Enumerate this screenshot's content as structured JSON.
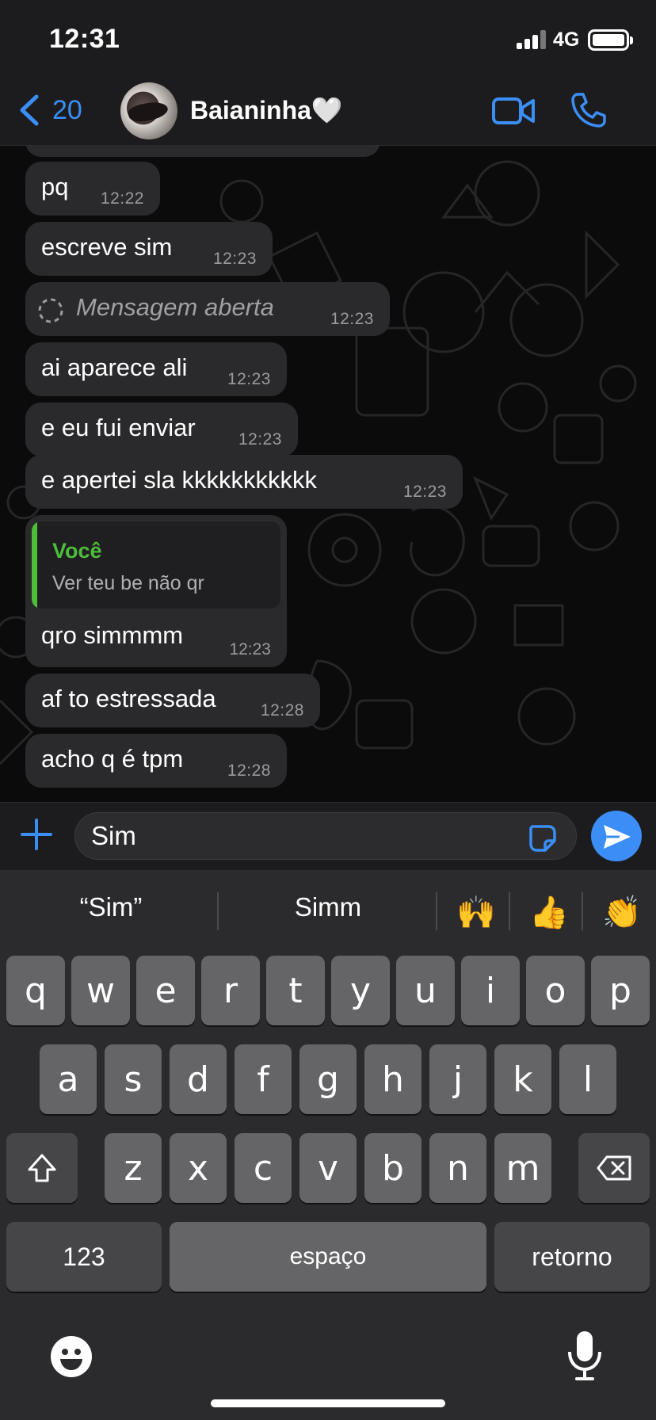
{
  "status_bar": {
    "time": "12:31",
    "network": "4G"
  },
  "header": {
    "back_count": "20",
    "contact_name": "Baianinha🤍"
  },
  "messages": [
    {
      "text": "pq",
      "time": "12:22"
    },
    {
      "text": "escreve sim",
      "time": "12:23"
    },
    {
      "text": "Mensagem aberta",
      "time": "12:23"
    },
    {
      "text": "ai aparece ali",
      "time": "12:23"
    },
    {
      "text": "e eu fui enviar",
      "time": "12:23"
    },
    {
      "text": "e apertei sla kkkkkkkkkkk",
      "time": "12:23"
    },
    {
      "quote_author": "Você",
      "quote_text": "Ver teu be não qr",
      "text": "qro simmmm",
      "time": "12:23"
    },
    {
      "text": "af to estressada",
      "time": "12:28"
    },
    {
      "text": "acho q é tpm",
      "time": "12:28"
    }
  ],
  "input": {
    "value": "Sim"
  },
  "keyboard": {
    "suggestions": [
      "“Sim”",
      "Simm"
    ],
    "emoji_suggestions": [
      "🙌",
      "👍",
      "👏"
    ],
    "row1": [
      "q",
      "w",
      "e",
      "r",
      "t",
      "y",
      "u",
      "i",
      "o",
      "p"
    ],
    "row2": [
      "a",
      "s",
      "d",
      "f",
      "g",
      "h",
      "j",
      "k",
      "l"
    ],
    "row3": [
      "z",
      "x",
      "c",
      "v",
      "b",
      "n",
      "m"
    ],
    "numbers_label": "123",
    "space_label": "espaço",
    "return_label": "retorno"
  },
  "colors": {
    "accent": "#3a8ef6",
    "quote_green": "#4dbd3a",
    "bubble": "#2a2a2c"
  }
}
